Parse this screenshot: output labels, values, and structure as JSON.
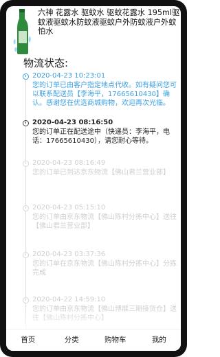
{
  "product": {
    "title": "六神 花露水 驱蚊水 驱蚊花露水 195ml驱蚊液驱蚊水防蚊液驱蚊户外防蚊液户外蚊怕水",
    "image_icon": "green-bottle-icon"
  },
  "logistics": {
    "section_title": "物流状态:",
    "events": [
      {
        "time": "2020-04-23 10:23:01",
        "desc": "您的订单已由客户指定地点代收。如有疑问您可以联系配送员【李海平，17665610430】确认。感谢您在优选商城购物，欢迎再次光临。"
      },
      {
        "time": "2020-04-23 08:16:50",
        "desc": "您的订单正在配送途中（快递员：李海平，电话：17665610430），请您耐心等待。"
      },
      {
        "time": "2020-04-23 08:16:49",
        "desc": "您的订单已到达京东物流【佛山君兰营业部】"
      },
      {
        "time": "2020-04-23 05:15:10",
        "desc": "您的订单由京东物流【佛山陈村分拣中心】送往【佛山君兰营业部】"
      },
      {
        "time": "2020-04-23 03:37:36",
        "desc": "您的订单在京东物流【佛山陈村分拣中心】分拣完成"
      },
      {
        "time": "2020-04-22 14:59:10",
        "desc": "您的订单由京东物流【佛山博展三期接货仓】送往【佛山陈村分拣中心】"
      }
    ]
  },
  "nav": {
    "home": "首页",
    "category": "分类",
    "cart": "购物车",
    "mine": "我的"
  },
  "colors": {
    "active": "#3b9fe0",
    "faded": "#cfcfcf"
  }
}
